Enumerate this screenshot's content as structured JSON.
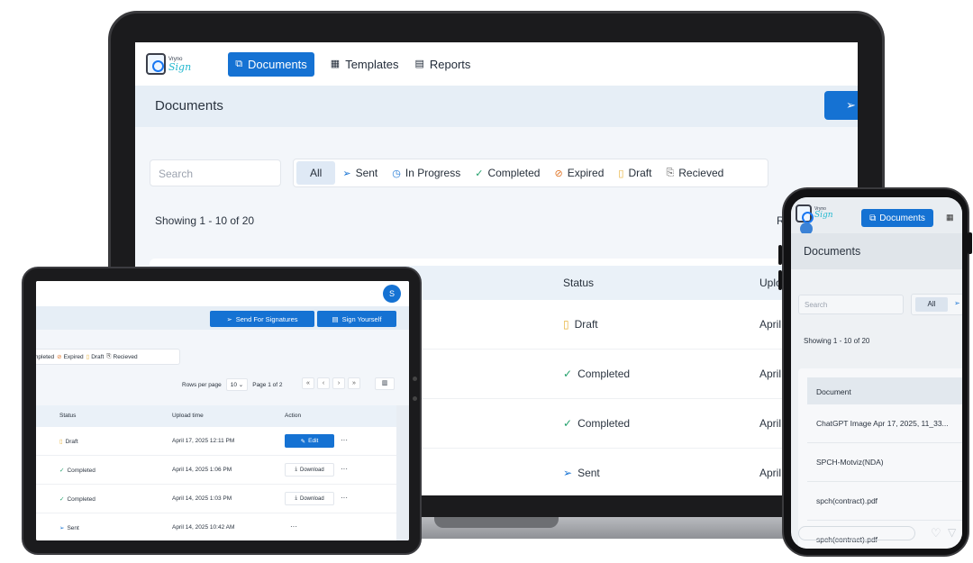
{
  "brand": {
    "logo_small": "Vryno",
    "logo_script": "Sign"
  },
  "laptop": {
    "nav": [
      {
        "label": "Documents",
        "icon": "document-icon",
        "glyph": "⧉",
        "active": true
      },
      {
        "label": "Templates",
        "icon": "template-icon",
        "glyph": "▦",
        "active": false
      },
      {
        "label": "Reports",
        "icon": "report-icon",
        "glyph": "▤",
        "active": false
      }
    ],
    "page_title": "Documents",
    "search_placeholder": "Search",
    "filters": [
      {
        "label": "All",
        "icon": "",
        "glyph": ""
      },
      {
        "label": "Sent",
        "icon": "send-icon",
        "glyph": "➢",
        "color": "#1572d3"
      },
      {
        "label": "In Progress",
        "icon": "clock-icon",
        "glyph": "◷",
        "color": "#1572d3"
      },
      {
        "label": "Completed",
        "icon": "check-circle-icon",
        "glyph": "✓",
        "color": "#22a06b"
      },
      {
        "label": "Expired",
        "icon": "expired-icon",
        "glyph": "⊘",
        "color": "#e0772b"
      },
      {
        "label": "Draft",
        "icon": "draft-icon",
        "glyph": "▯",
        "color": "#e7b23a"
      },
      {
        "label": "Recieved",
        "icon": "received-icon",
        "glyph": "⎘",
        "color": "#555"
      }
    ],
    "showing": "Showing 1 - 10 of 20",
    "rows_right": "R",
    "columns": {
      "status": "Status",
      "upload": "Uplo"
    },
    "rows": [
      {
        "status": "Draft",
        "status_icon": "draft-icon",
        "glyph": "▯",
        "color": "#e7b23a",
        "upload": "April"
      },
      {
        "status": "Completed",
        "status_icon": "check-circle-icon",
        "glyph": "✓",
        "color": "#22a06b",
        "upload": "April"
      },
      {
        "status": "Completed",
        "status_icon": "check-circle-icon",
        "glyph": "✓",
        "color": "#22a06b",
        "upload": "April"
      },
      {
        "status": "Sent",
        "status_icon": "send-icon",
        "glyph": "➢",
        "color": "#1572d3",
        "upload": "April"
      }
    ]
  },
  "tablet": {
    "avatar": "S",
    "send_for_signatures": "Send For Signatures",
    "sign_yourself": "Sign Yourself",
    "filters": [
      {
        "label": "mpleted",
        "glyph": "",
        "color": "#22a06b"
      },
      {
        "label": "Expired",
        "glyph": "⊘",
        "color": "#e0772b"
      },
      {
        "label": "Draft",
        "glyph": "▯",
        "color": "#e7b23a"
      },
      {
        "label": "Recieved",
        "glyph": "⎘",
        "color": "#555"
      }
    ],
    "rows_per_page_label": "Rows per page",
    "rows_per_page_value": "10",
    "page_info": "Page 1 of 2",
    "pager": [
      "«",
      "‹",
      "›",
      "»"
    ],
    "columns": {
      "status": "Status",
      "upload_time": "Upload time",
      "action": "Action"
    },
    "rows": [
      {
        "status": "Draft",
        "glyph": "▯",
        "color": "#e7b23a",
        "time": "April 17, 2025 12:11 PM",
        "action": "Edit",
        "action_glyph": "✎"
      },
      {
        "status": "Completed",
        "glyph": "✓",
        "color": "#22a06b",
        "time": "April 14, 2025 1:06 PM",
        "action": "Download",
        "action_glyph": "⤓"
      },
      {
        "status": "Completed",
        "glyph": "✓",
        "color": "#22a06b",
        "time": "April 14, 2025 1:03 PM",
        "action": "Download",
        "action_glyph": "⤓"
      },
      {
        "status": "Sent",
        "glyph": "➢",
        "color": "#1572d3",
        "time": "April 14, 2025 10:42 AM",
        "action": "",
        "action_glyph": ""
      }
    ],
    "more": "···"
  },
  "phone": {
    "nav_label": "Documents",
    "page_title": "Documents",
    "search_placeholder": "Search",
    "all_label": "All",
    "showing": "Showing 1 - 10 of 20",
    "column_document": "Document",
    "documents": [
      "ChatGPT Image Apr 17, 2025, 11_33...",
      "SPCH-Motviz(NDA)",
      "spch(contract).pdf",
      "spch(contract).pdf"
    ]
  }
}
